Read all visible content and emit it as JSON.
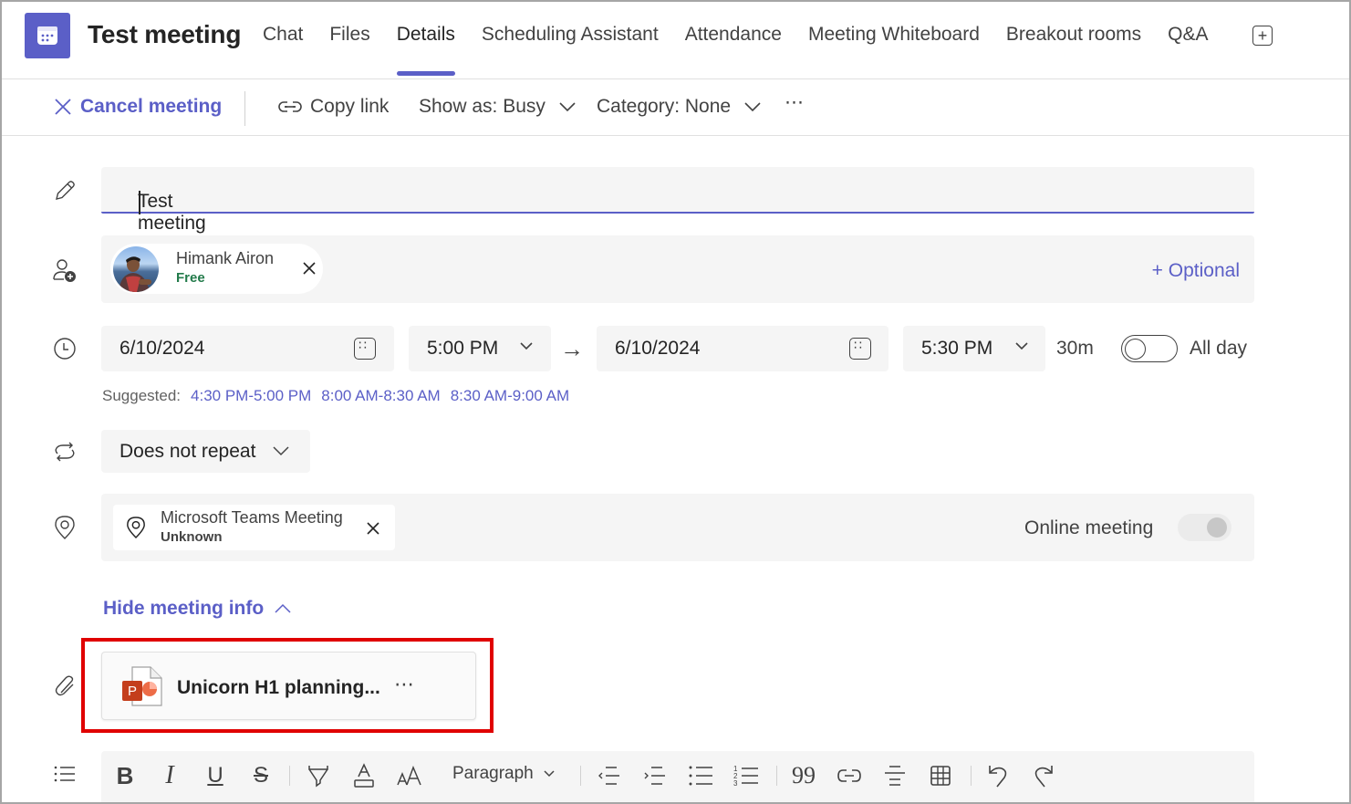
{
  "header": {
    "title": "Test meeting",
    "tabs": [
      {
        "label": "Chat",
        "active": false
      },
      {
        "label": "Files",
        "active": false
      },
      {
        "label": "Details",
        "active": true
      },
      {
        "label": "Scheduling Assistant",
        "active": false
      },
      {
        "label": "Attendance",
        "active": false
      },
      {
        "label": "Meeting Whiteboard",
        "active": false
      },
      {
        "label": "Breakout rooms",
        "active": false
      },
      {
        "label": "Q&A",
        "active": false
      }
    ],
    "add_tab_icon": "plus-square-icon"
  },
  "toolbar": {
    "cancel_label": "Cancel meeting",
    "copy_link_label": "Copy link",
    "show_as_label": "Show as: Busy",
    "category_label": "Category: None",
    "more_label": "⋯"
  },
  "form": {
    "title_value": "Test meeting",
    "attendees": [
      {
        "name": "Himank Airon",
        "status": "Free"
      }
    ],
    "optional_label": "+ Optional",
    "start_date": "6/10/2024",
    "start_time": "5:00 PM",
    "end_date": "6/10/2024",
    "end_time": "5:30 PM",
    "duration": "30m",
    "all_day_label": "All day",
    "all_day_on": false,
    "suggested_label": "Suggested:",
    "suggested_slots": [
      "4:30 PM-5:00 PM",
      "8:00 AM-8:30 AM",
      "8:30 AM-9:00 AM"
    ],
    "repeat_value": "Does not repeat",
    "location": {
      "name": "Microsoft Teams Meeting",
      "status": "Unknown"
    },
    "online_meeting_label": "Online meeting",
    "online_meeting_on": true,
    "hide_info_label": "Hide meeting info",
    "attachment": {
      "name": "Unicorn H1 planning...",
      "type": "PowerPoint",
      "more": "⋯"
    }
  },
  "editor": {
    "paragraph_label": "Paragraph",
    "buttons": [
      "bold",
      "italic",
      "underline",
      "strikethrough",
      "highlight",
      "font-color",
      "font-size",
      "paragraph",
      "decrease-indent",
      "increase-indent",
      "bulleted-list",
      "numbered-list",
      "quote",
      "link",
      "horizontal-rule",
      "table",
      "undo",
      "redo"
    ]
  },
  "colors": {
    "accent": "#5b5fc7",
    "free_status": "#237b4b",
    "highlight_box": "#e00000",
    "powerpoint": "#c43e1c"
  }
}
